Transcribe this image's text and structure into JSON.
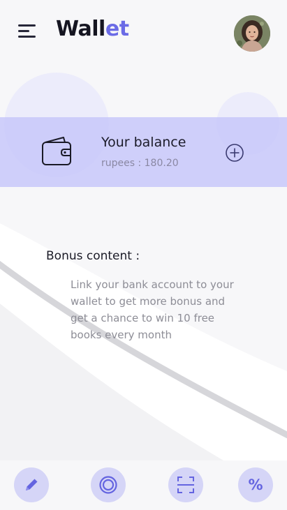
{
  "header": {
    "title_part1": "Wall",
    "title_part2": "et",
    "menu_icon": "hamburger-icon",
    "avatar_icon": "user-avatar"
  },
  "balance": {
    "title": "Your balance",
    "amount_text": "rupees : 180.20",
    "wallet_icon": "wallet-icon",
    "add_icon": "plus-circle-icon"
  },
  "bonus": {
    "title": "Bonus content :",
    "text": "Link your bank account to your wallet to get more bonus and get a chance to win 10 free books every month"
  },
  "bottom_nav": {
    "items": [
      {
        "icon": "pencil-icon"
      },
      {
        "icon": "target-icon"
      },
      {
        "icon": "scan-icon"
      },
      {
        "icon": "percent-icon",
        "label": "%"
      }
    ]
  },
  "colors": {
    "accent": "#6b6be6",
    "band": "#c4c4fa",
    "button_bg": "#d5d5f7",
    "background": "#f7f7f9"
  }
}
